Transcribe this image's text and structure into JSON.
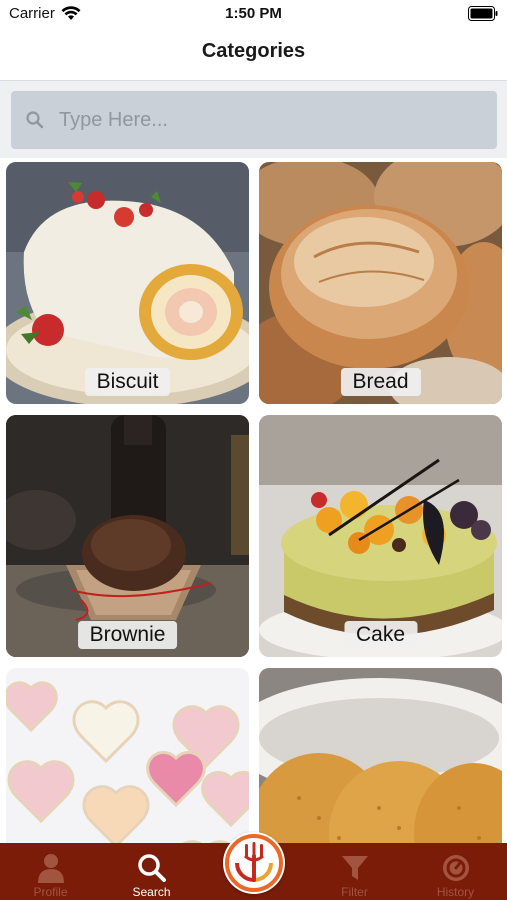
{
  "status_bar": {
    "carrier": "Carrier",
    "time": "1:50 PM"
  },
  "header": {
    "title": "Categories"
  },
  "search": {
    "placeholder": "Type Here...",
    "value": ""
  },
  "categories": [
    {
      "label": "Biscuit",
      "image": "swiss-roll-photo"
    },
    {
      "label": "Bread",
      "image": "bread-loaves-photo"
    },
    {
      "label": "Brownie",
      "image": "chocolate-muffin-photo"
    },
    {
      "label": "Cake",
      "image": "fruit-cheesecake-photo"
    },
    {
      "label": "",
      "image": "heart-cookies-photo"
    },
    {
      "label": "",
      "image": "crackers-photo"
    }
  ],
  "tabs": [
    {
      "label": "Profile",
      "icon": "person-icon",
      "active": false
    },
    {
      "label": "Search",
      "icon": "search-icon",
      "active": true
    },
    {
      "label": "",
      "icon": "fork-logo-icon",
      "active": false
    },
    {
      "label": "Filter",
      "icon": "filter-icon",
      "active": false
    },
    {
      "label": "History",
      "icon": "history-icon",
      "active": false
    }
  ],
  "colors": {
    "tab_bar": "#7a1c08",
    "search_bg": "#c9d0d8",
    "accent_orange": "#e8692a"
  }
}
